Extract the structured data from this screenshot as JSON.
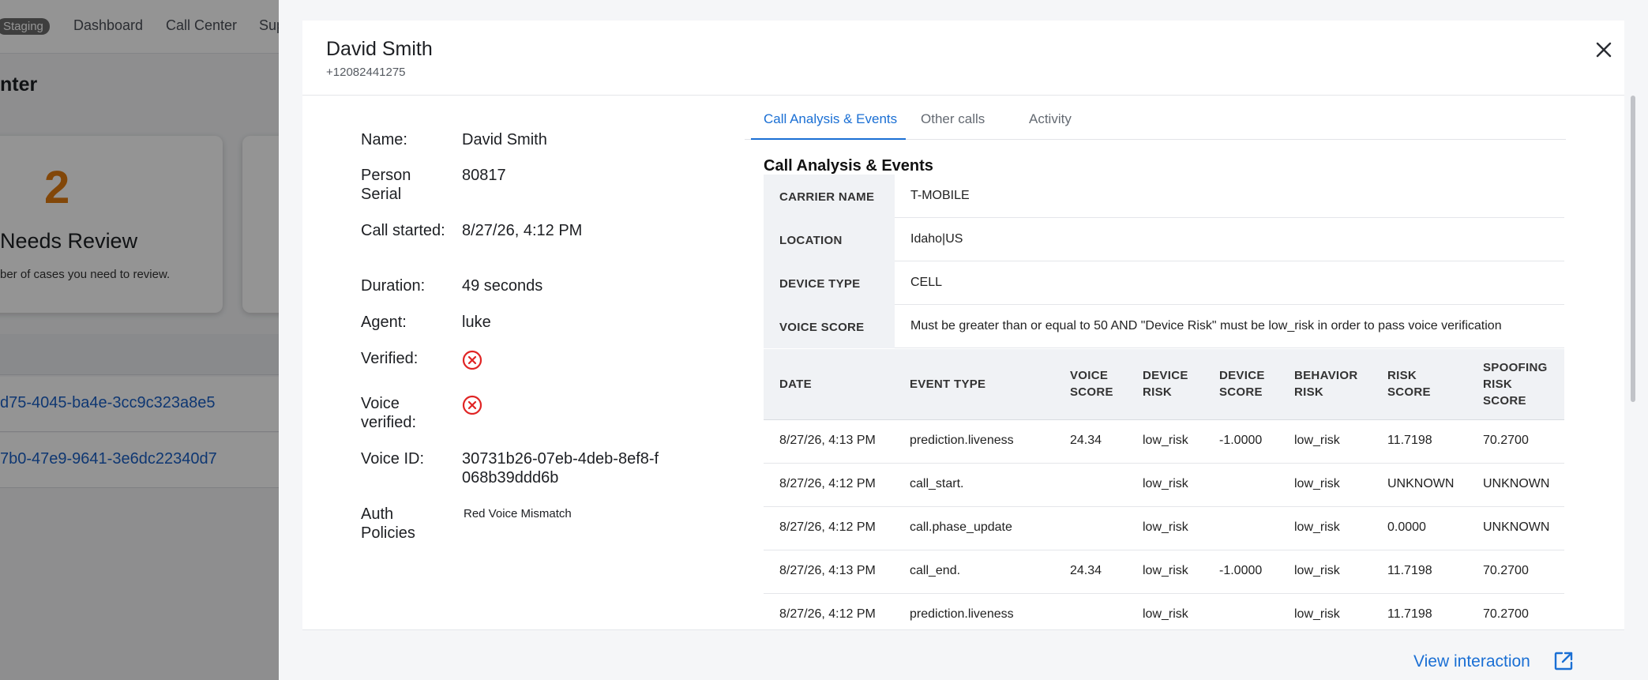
{
  "background": {
    "env_badge": "Staging",
    "nav": [
      "Dashboard",
      "Call Center",
      "Sup"
    ],
    "page_title": "nter",
    "card": {
      "count": "2",
      "label": "Needs Review",
      "description": "ber of cases you need to review."
    },
    "rows": [
      "d75-4045-ba4e-3cc9c323a8e5",
      "7b0-47e9-9641-3e6dc22340d7"
    ]
  },
  "drawer": {
    "name": "David Smith",
    "phone": "+12082441275",
    "close_icon": "close-icon",
    "details": [
      {
        "label": "Name:",
        "value": "David Smith"
      },
      {
        "label": "Person Serial",
        "value": "80817"
      },
      {
        "label": "Call started:",
        "value": "8/27/26, 4:12 PM"
      },
      {
        "label": "Duration:",
        "value": "49 seconds"
      },
      {
        "label": "Agent:",
        "value": "luke"
      },
      {
        "label": "Verified:",
        "value": ""
      },
      {
        "label": "Voice verified:",
        "value": ""
      },
      {
        "label": "Voice ID:",
        "value": "30731b26-07eb-4deb-8ef8-f068b39ddd6b"
      },
      {
        "label": "Auth Policies",
        "value": "Red Voice Mismatch"
      }
    ],
    "status_icons": {
      "verified": "x-circle-icon",
      "voice_verified": "x-circle-icon",
      "color": "#e02424"
    },
    "tabs": [
      "Call Analysis & Events",
      "Other calls",
      "Activity"
    ],
    "active_tab": "Call Analysis & Events",
    "section_title": "Call Analysis & Events",
    "info": [
      {
        "key": "CARRIER NAME",
        "value": "T-MOBILE"
      },
      {
        "key": "LOCATION",
        "value": "Idaho|US"
      },
      {
        "key": "DEVICE TYPE",
        "value": "CELL"
      },
      {
        "key": "VOICE SCORE",
        "value": "Must be greater than or equal to 50 AND \"Device Risk\" must be low_risk in order to pass voice verification"
      }
    ],
    "event_headers": {
      "date": "DATE",
      "event_type": "EVENT TYPE",
      "voice_score": [
        "VOICE",
        "SCORE"
      ],
      "device_risk": [
        "DEVICE",
        "RISK"
      ],
      "device_score": [
        "DEVICE",
        "SCORE"
      ],
      "behavior_risk": [
        "BEHAVIOR",
        "RISK"
      ],
      "risk_score": [
        "RISK",
        "SCORE"
      ],
      "spoofing_risk_score": [
        "SPOOFING",
        "RISK",
        "SCORE"
      ]
    },
    "events": [
      {
        "date": "8/27/26, 4:13 PM",
        "event_type": "prediction.liveness",
        "voice_score": "24.34",
        "device_risk": "low_risk",
        "device_score": "-1.0000",
        "behavior_risk": "low_risk",
        "risk_score": "11.7198",
        "spoofing_risk_score": "70.2700"
      },
      {
        "date": "8/27/26, 4:12 PM",
        "event_type": "call_start.",
        "voice_score": "",
        "device_risk": "low_risk",
        "device_score": "",
        "behavior_risk": "low_risk",
        "risk_score": "UNKNOWN",
        "spoofing_risk_score": "UNKNOWN"
      },
      {
        "date": "8/27/26, 4:12 PM",
        "event_type": "call.phase_update",
        "voice_score": "",
        "device_risk": "low_risk",
        "device_score": "",
        "behavior_risk": "low_risk",
        "risk_score": "0.0000",
        "spoofing_risk_score": "UNKNOWN"
      },
      {
        "date": "8/27/26, 4:13 PM",
        "event_type": "call_end.",
        "voice_score": "24.34",
        "device_risk": "low_risk",
        "device_score": "-1.0000",
        "behavior_risk": "low_risk",
        "risk_score": "11.7198",
        "spoofing_risk_score": "70.2700"
      },
      {
        "date": "8/27/26, 4:12 PM",
        "event_type": "prediction.liveness",
        "voice_score": "",
        "device_risk": "low_risk",
        "device_score": "",
        "behavior_risk": "low_risk",
        "risk_score": "11.7198",
        "spoofing_risk_score": "70.2700"
      }
    ],
    "footer": {
      "view_label": "View interaction",
      "icon": "external-link-icon"
    }
  }
}
